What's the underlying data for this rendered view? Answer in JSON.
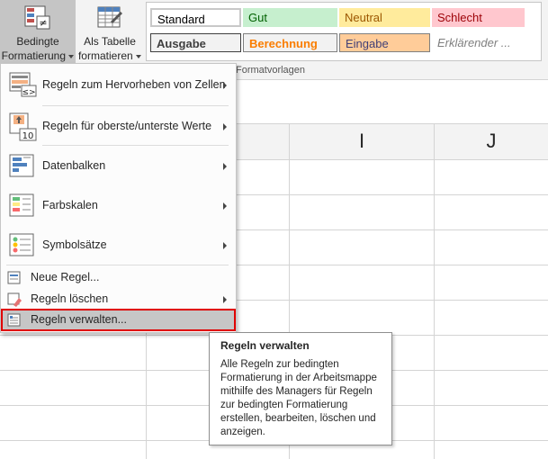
{
  "ribbon": {
    "conditional_formatting": {
      "line1": "Bedingte",
      "line2": "Formatierung"
    },
    "format_as_table": {
      "line1": "Als Tabelle",
      "line2": "formatieren"
    },
    "styles": {
      "standard": "Standard",
      "gut": "Gut",
      "neutral": "Neutral",
      "schlecht": "Schlecht",
      "ausgabe": "Ausgabe",
      "berechnung": "Berechnung",
      "eingabe": "Eingabe",
      "erklaerender": "Erklärender ..."
    },
    "group_label": "Formatvorlagen"
  },
  "columns": {
    "i": "I",
    "j": "J"
  },
  "menu": {
    "items": [
      {
        "label": "Regeln zum Hervorheben von Zellen",
        "icon": "highlight-cells-rules-icon",
        "submenu": true
      },
      {
        "label": "Regeln für oberste/unterste Werte",
        "icon": "top-bottom-rules-icon",
        "submenu": true
      },
      {
        "label": "Datenbalken",
        "icon": "data-bars-icon",
        "submenu": true
      },
      {
        "label": "Farbskalen",
        "icon": "color-scales-icon",
        "submenu": true
      },
      {
        "label": "Symbolsätze",
        "icon": "icon-sets-icon",
        "submenu": true
      },
      {
        "label": "Neue Regel...",
        "icon": "new-rule-icon",
        "submenu": false
      },
      {
        "label": "Regeln löschen",
        "icon": "clear-rules-icon",
        "submenu": true
      },
      {
        "label": "Regeln verwalten...",
        "icon": "manage-rules-icon",
        "submenu": false
      }
    ]
  },
  "tooltip": {
    "title": "Regeln verwalten",
    "body": "Alle Regeln zur bedingten Formatierung in der Arbeitsmappe mithilfe des Managers für Regeln zur bedingten Formatierung erstellen, bearbeiten, löschen und anzeigen."
  },
  "colors": {
    "gut_bg": "#c6efce",
    "gut_fg": "#006100",
    "neutral_bg": "#ffeb9c",
    "neutral_fg": "#9c5700",
    "schlecht_bg": "#ffc7ce",
    "schlecht_fg": "#9c0006",
    "eingabe_bg": "#ffcc99",
    "berechnung_fg": "#fa7d00",
    "selection_outline": "#e00000"
  }
}
